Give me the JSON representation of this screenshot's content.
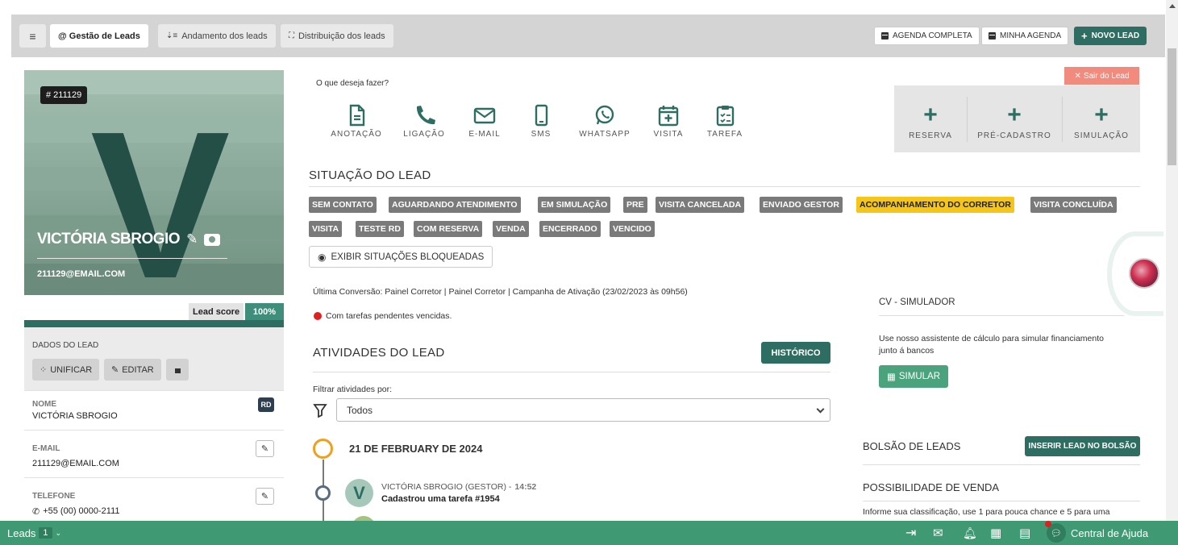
{
  "tabs": {
    "menu_icon": "hamburger-icon",
    "gestao": "@ Gestão de Leads",
    "andamento": "Andamento dos leads",
    "distribuicao": "Distribuição dos leads"
  },
  "top_actions": {
    "agenda_completa": "AGENDA COMPLETA",
    "minha_agenda": "MINHA AGENDA",
    "novo_lead": "NOVO LEAD"
  },
  "lead": {
    "id_badge": "# 211129",
    "initial": "V",
    "name": "VICTÓRIA SBROGIO",
    "email": "211129@EMAIL.COM",
    "score_label": "Lead score",
    "score_value": "100%"
  },
  "dados": {
    "title": "DADOS DO LEAD",
    "unificar": "UNIFICAR",
    "editar": "EDITAR",
    "fields": [
      {
        "label": "NOME",
        "value": "VICTÓRIA SBROGIO",
        "badge": "RD"
      },
      {
        "label": "E-MAIL",
        "value": "211129@EMAIL.COM"
      },
      {
        "label": "TELEFONE",
        "value": "+55 (00) 0000-2111"
      }
    ]
  },
  "actions": {
    "prompt": "O que deseja fazer?",
    "items": [
      "ANOTAÇÃO",
      "LIGAÇÃO",
      "E-MAIL",
      "SMS",
      "WHATSAPP",
      "VISITA",
      "TAREFA"
    ],
    "right_items": [
      "RESERVA",
      "PRÉ-CADASTRO",
      "SIMULAÇÃO"
    ],
    "exit": "Sair do Lead"
  },
  "situacao": {
    "title": "SITUAÇÃO DO LEAD",
    "tags": [
      "SEM CONTATO",
      "AGUARDANDO ATENDIMENTO",
      "EM SIMULAÇÃO",
      "PRE",
      "VISITA CANCELADA",
      "ENVIADO GESTOR",
      "ACOMPANHAMENTO DO CORRETOR",
      "VISITA CONCLUÍDA",
      "VISITA",
      "TESTE RD",
      "COM RESERVA",
      "VENDA",
      "ENCERRADO",
      "VENCIDO"
    ],
    "highlighted": "ACOMPANHAMENTO DO CORRETOR",
    "exibir": "EXIBIR SITUAÇÕES BLOQUEADAS",
    "ultima_conversao": "Última Conversão: Painel Corretor | Painel Corretor | Campanha de Ativação (23/02/2023 às 09h56)",
    "pendentes": "Com tarefas pendentes vencidas."
  },
  "atividades": {
    "title": "ATIVIDADES DO LEAD",
    "historico": "HISTÓRICO",
    "filter_label": "Filtrar atividades por:",
    "filter_value": "Todos",
    "date": "21 DE FEBRUARY DE 2024",
    "entry_author": "VICTÓRIA SBROGIO (GESTOR) -",
    "entry_time": "14:52",
    "entry_text": "Cadastrou uma tarefa #1954"
  },
  "simulador": {
    "title": "CV - SIMULADOR",
    "desc_line1": "Use nosso assistente de cálculo para simular financiamento",
    "desc_line2": "junto á bancos",
    "button": "SIMULAR"
  },
  "bolsao": {
    "title": "BOLSÃO DE LEADS",
    "button": "INSERIR LEAD NO BOLSÃO"
  },
  "possibilidade": {
    "title": "POSSIBILIDADE DE VENDA",
    "text": "Informe sua classificação, use 1 para pouca chance e 5 para uma"
  },
  "bottombar": {
    "leads_label": "Leads",
    "leads_count": "1",
    "help": "Central de Ajuda"
  },
  "colors": {
    "brand": "#2e6e62",
    "bottombar": "#3f9a74",
    "highlight_tag": "#f5c518",
    "exit": "#f08b7e"
  }
}
